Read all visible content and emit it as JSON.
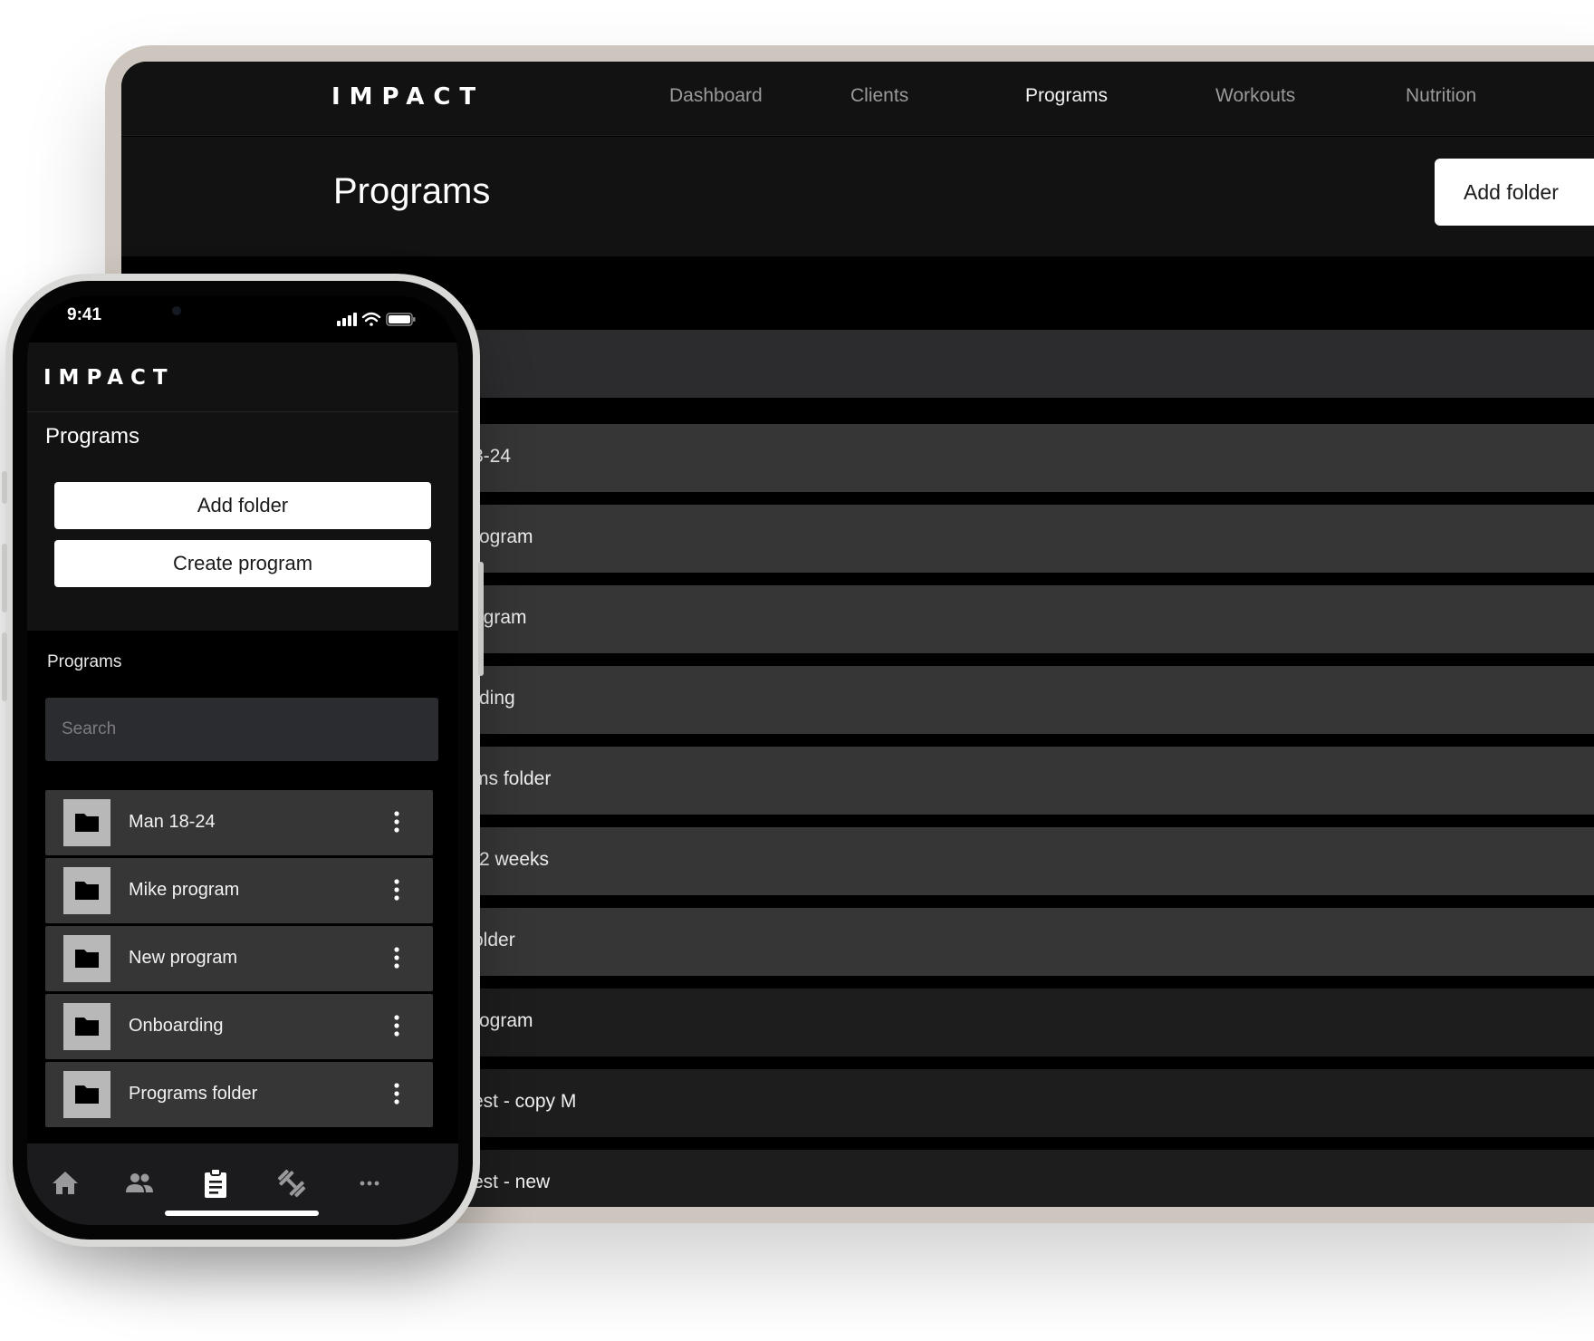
{
  "desktop": {
    "logo": "IMPACT",
    "nav": [
      {
        "label": "Dashboard",
        "active": false
      },
      {
        "label": "Clients",
        "active": false
      },
      {
        "label": "Programs",
        "active": true
      },
      {
        "label": "Workouts",
        "active": false
      },
      {
        "label": "Nutrition",
        "active": false
      }
    ],
    "page_title": "Programs",
    "add_folder_label": "Add folder",
    "rows": [
      {
        "label": ""
      },
      {
        "label": "3-24"
      },
      {
        "label": "rogram"
      },
      {
        "label": "ogram"
      },
      {
        "label": "rding"
      },
      {
        "label": "ms folder"
      },
      {
        "label": "-2 weeks"
      },
      {
        "label": "older"
      },
      {
        "label": "rogram"
      },
      {
        "label": "est - copy M"
      },
      {
        "label": "est - new"
      }
    ]
  },
  "phone": {
    "status_time": "9:41",
    "logo": "IMPACT",
    "page_title": "Programs",
    "add_folder_label": "Add folder",
    "create_program_label": "Create program",
    "section_label": "Programs",
    "search_placeholder": "Search",
    "items": [
      {
        "label": "Man 18-24",
        "icon": "folder-icon"
      },
      {
        "label": "Mike program",
        "icon": "folder-icon"
      },
      {
        "label": "New program",
        "icon": "folder-icon"
      },
      {
        "label": "Onboarding",
        "icon": "folder-icon"
      },
      {
        "label": "Programs folder",
        "icon": "folder-icon"
      }
    ],
    "tabs": [
      {
        "icon": "home-icon",
        "active": false
      },
      {
        "icon": "clients-icon",
        "active": false
      },
      {
        "icon": "clipboard-icon",
        "active": true
      },
      {
        "icon": "dumbbell-icon",
        "active": false
      },
      {
        "icon": "more-icon",
        "active": false
      }
    ]
  },
  "colors": {
    "background": "#ffffff",
    "tablet_bezel": "#cdc6be",
    "app_bg": "#000000",
    "header_bg": "#121212",
    "row_bg": "#363636",
    "row_dark_bg": "#1d1d1e",
    "button_bg": "#ffffff",
    "search_bg": "#2b2c30"
  }
}
